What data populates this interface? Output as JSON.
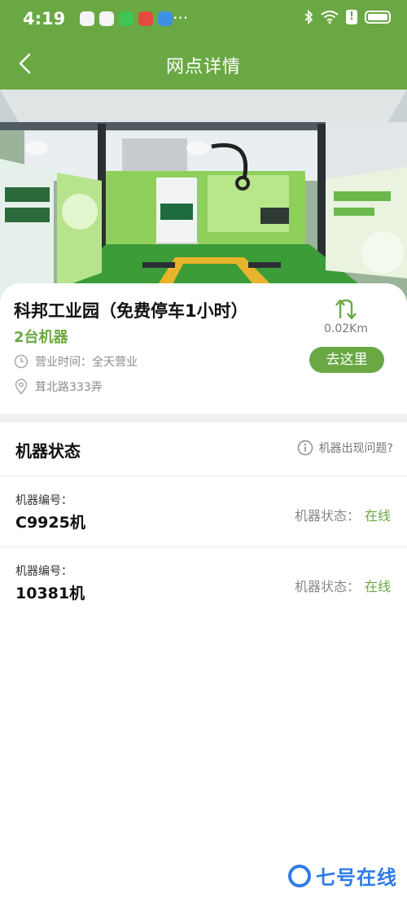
{
  "status_bar": {
    "time": "4:19",
    "more": "···",
    "battery_alert": "!"
  },
  "nav": {
    "title": "网点详情"
  },
  "station": {
    "name": "科邦工业园（免费停车1小时）",
    "machine_count": "2台机器",
    "hours": "营业时间：全天营业",
    "address": "茸北路333弄",
    "distance": "0.02Km",
    "goto_label": "去这里"
  },
  "machine_section": {
    "title": "机器状态",
    "problem_link": "机器出现问题?",
    "machines": [
      {
        "label": "机器编号：",
        "id": "C9925机",
        "status_label": "机器状态：",
        "status": "在线"
      },
      {
        "label": "机器编号：",
        "id": "10381机",
        "status_label": "机器状态：",
        "status": "在线"
      }
    ]
  },
  "watermark": {
    "text": "七号在线"
  },
  "colors": {
    "brand_green": "#6aa844",
    "watermark_blue": "#2f7be6"
  }
}
